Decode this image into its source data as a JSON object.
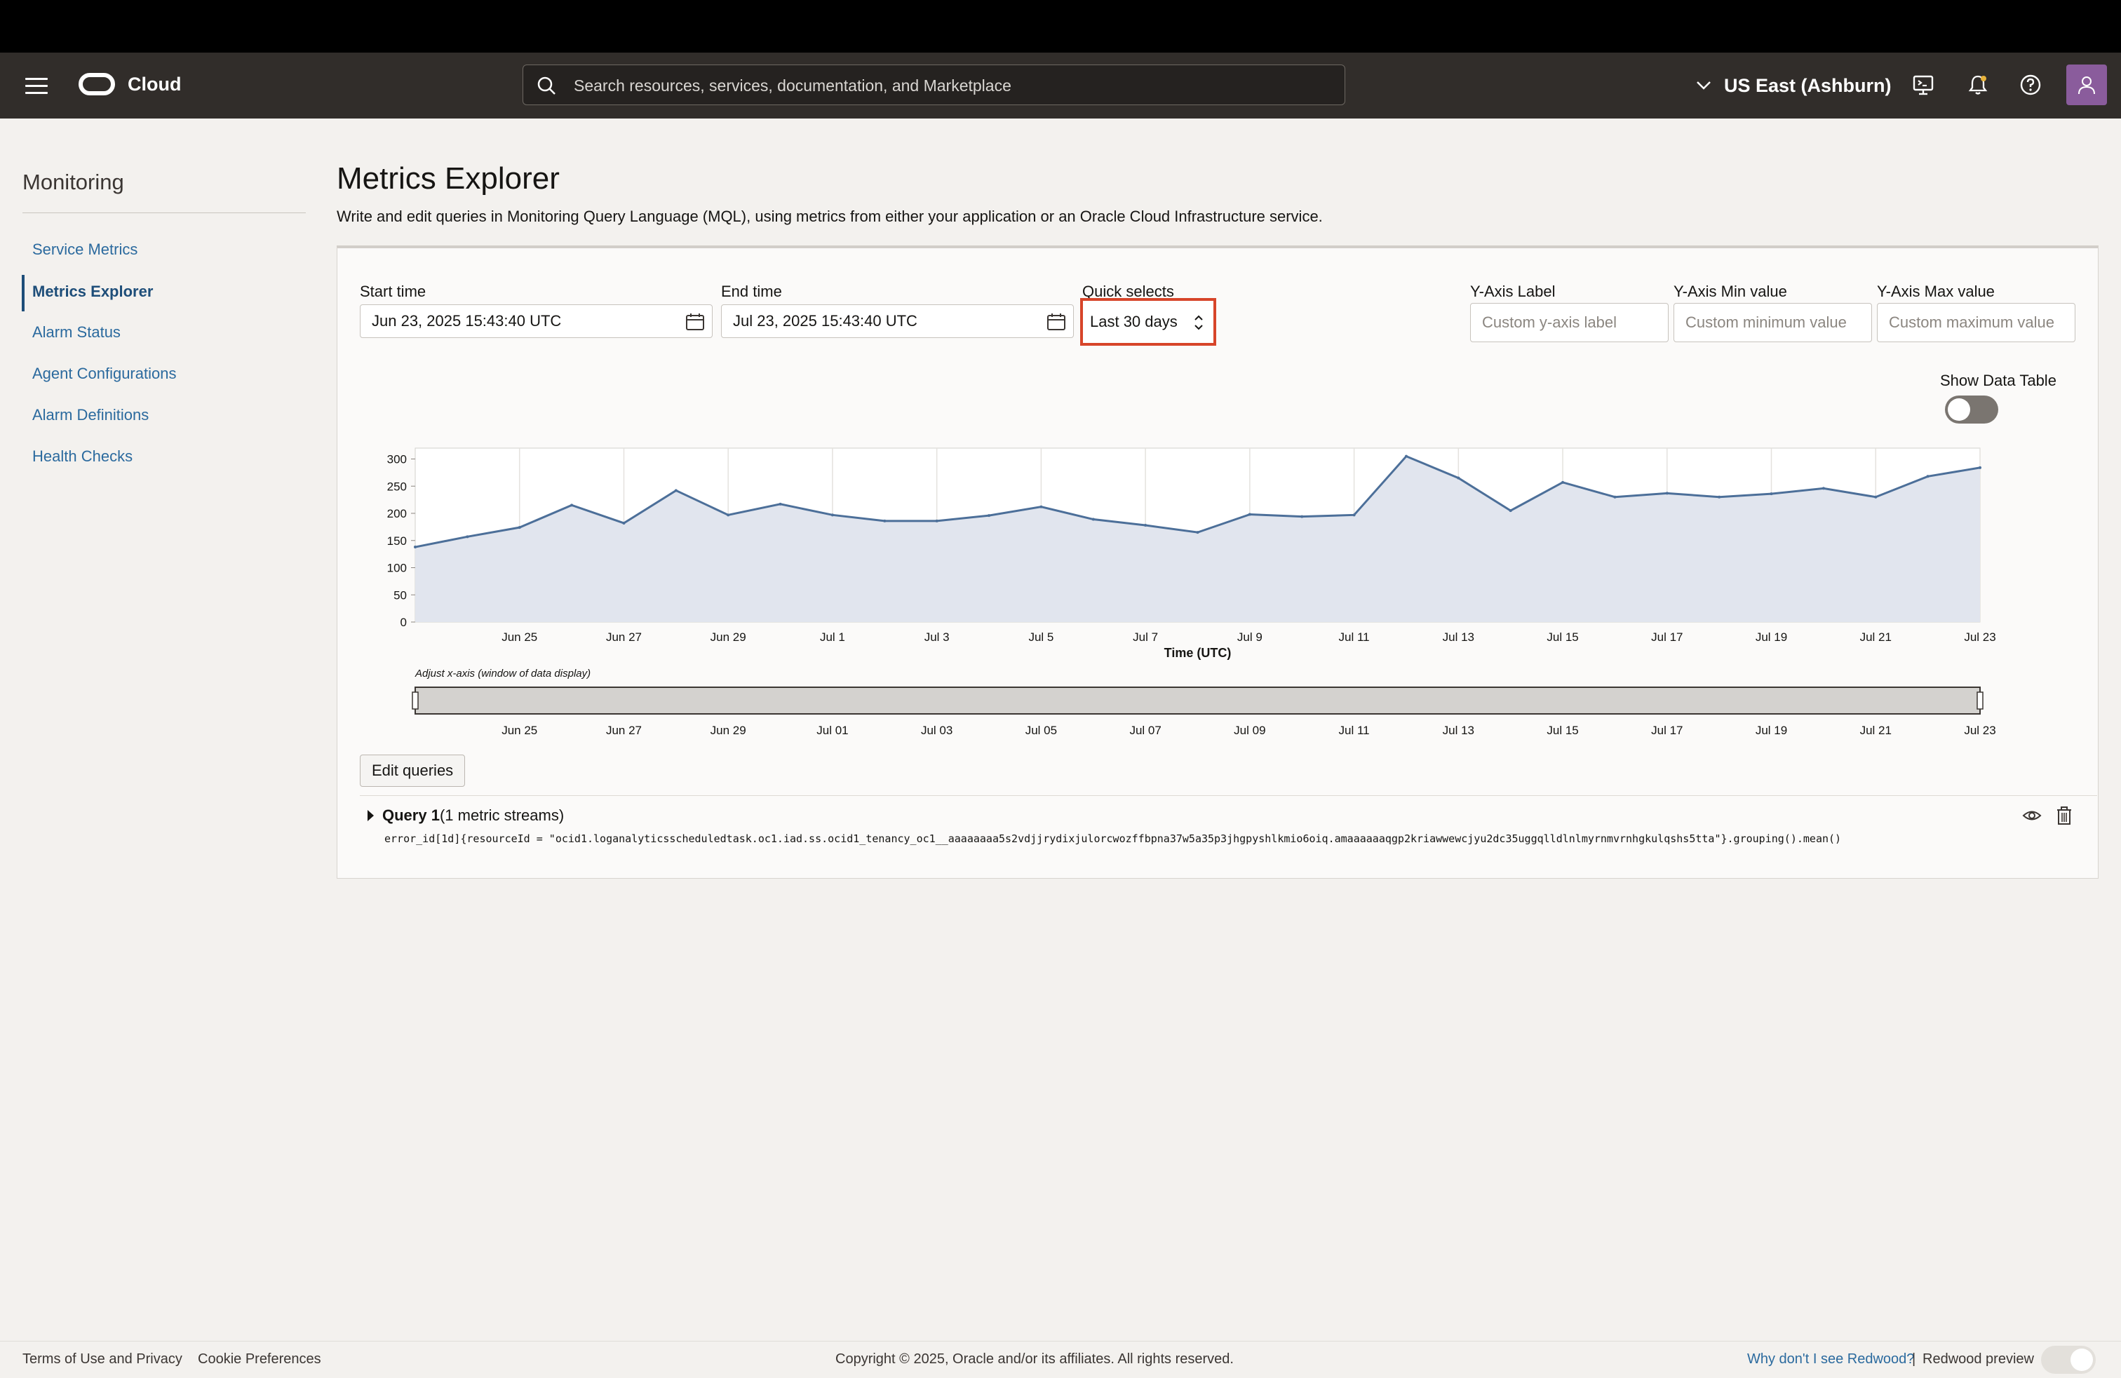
{
  "header": {
    "brand": "Cloud",
    "search_placeholder": "Search resources, services, documentation, and Marketplace",
    "region": "US East (Ashburn)"
  },
  "sidebar": {
    "title": "Monitoring",
    "items": [
      {
        "label": "Service Metrics"
      },
      {
        "label": "Metrics Explorer"
      },
      {
        "label": "Alarm Status"
      },
      {
        "label": "Agent Configurations"
      },
      {
        "label": "Alarm Definitions"
      },
      {
        "label": "Health Checks"
      }
    ]
  },
  "page": {
    "title": "Metrics Explorer",
    "description": "Write and edit queries in Monitoring Query Language (MQL), using metrics from either your application or an Oracle Cloud Infrastructure service."
  },
  "form": {
    "start_label": "Start time",
    "start_value": "Jun 23, 2025 15:43:40 UTC",
    "end_label": "End time",
    "end_value": "Jul 23, 2025 15:43:40 UTC",
    "quick_label": "Quick selects",
    "quick_value": "Last 30 days",
    "yaxis_label": "Y-Axis Label",
    "yaxis_placeholder": "Custom y-axis label",
    "ymin_label": "Y-Axis Min value",
    "ymin_placeholder": "Custom minimum value",
    "ymax_label": "Y-Axis Max value",
    "ymax_placeholder": "Custom maximum value",
    "show_table_label": "Show Data Table"
  },
  "chart_data": {
    "type": "area",
    "xlabel": "Time (UTC)",
    "ylim": [
      0,
      320
    ],
    "yticks": [
      0,
      50,
      100,
      150,
      200,
      250,
      300
    ],
    "xtick_labels": [
      "Jun 25",
      "Jun 27",
      "Jun 29",
      "Jul 1",
      "Jul 3",
      "Jul 5",
      "Jul 7",
      "Jul 9",
      "Jul 11",
      "Jul 13",
      "Jul 15",
      "Jul 17",
      "Jul 19",
      "Jul 21",
      "Jul 23"
    ],
    "x": [
      "Jun 23",
      "Jun 24",
      "Jun 25",
      "Jun 26",
      "Jun 27",
      "Jun 28",
      "Jun 29",
      "Jun 30",
      "Jul 1",
      "Jul 2",
      "Jul 3",
      "Jul 4",
      "Jul 5",
      "Jul 6",
      "Jul 7",
      "Jul 8",
      "Jul 9",
      "Jul 10",
      "Jul 11",
      "Jul 12",
      "Jul 13",
      "Jul 14",
      "Jul 15",
      "Jul 16",
      "Jul 17",
      "Jul 18",
      "Jul 19",
      "Jul 20",
      "Jul 21",
      "Jul 22",
      "Jul 23"
    ],
    "values": [
      138,
      157,
      174,
      215,
      182,
      242,
      197,
      217,
      197,
      186,
      186,
      196,
      212,
      189,
      178,
      165,
      198,
      194,
      197,
      305,
      265,
      205,
      257,
      230,
      237,
      230,
      236,
      246,
      230,
      268,
      284
    ],
    "grid": true,
    "series_color": "#4c6f99",
    "fill_color": "#e1e5ee"
  },
  "range_slider": {
    "label": "Adjust x-axis (window of data display)",
    "ticks": [
      "Jun 25",
      "Jun 27",
      "Jun 29",
      "Jul 01",
      "Jul 03",
      "Jul 05",
      "Jul 07",
      "Jul 09",
      "Jul 11",
      "Jul 13",
      "Jul 15",
      "Jul 17",
      "Jul 19",
      "Jul 21",
      "Jul 23"
    ]
  },
  "queries": {
    "edit_label": "Edit queries",
    "q1_name": "Query 1",
    "q1_streams": "(1 metric streams)",
    "q1_code": "error_id[1d]{resourceId = \"ocid1.loganalyticsscheduledtask.oc1.iad.ss.ocid1_tenancy_oc1__aaaaaaaa5s2vdjjrydixjulorcwozffbpna37w5a35p3jhgpyshlkmio6oiq.amaaaaaaqgp2kriawwewcjyu2dc35uggqlldlnlmyrnmvrnhgkulqshs5tta\"}.grouping().mean()"
  },
  "footer": {
    "terms": "Terms of Use and Privacy",
    "cookies": "Cookie Preferences",
    "copyright": "Copyright © 2025, Oracle and/or its affiliates. All rights reserved.",
    "redwood_link": "Why don't I see Redwood?",
    "separator": "|",
    "redwood_preview": "Redwood preview"
  }
}
